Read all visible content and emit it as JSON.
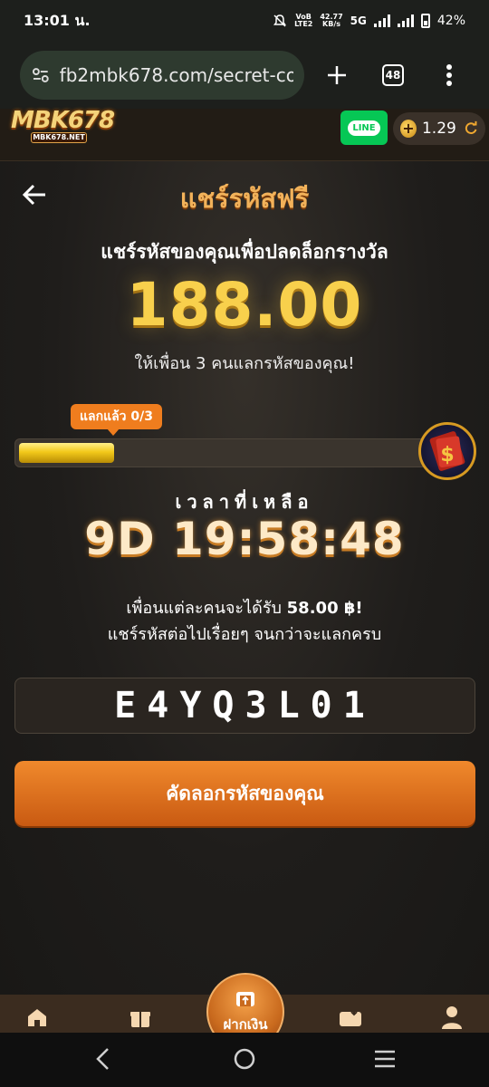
{
  "status_bar": {
    "time": "13:01 น.",
    "net_top": "VoB",
    "net_bottom": "LTE2",
    "speed_top": "42.77",
    "speed_bottom": "KB/s",
    "network": "5G",
    "battery": "42%"
  },
  "browser": {
    "url": "fb2mbk678.com/secret-co",
    "tab_count": "48"
  },
  "site_header": {
    "logo_text": "MBK678",
    "logo_sub": "MBK678.NET",
    "line_label": "LINE",
    "balance": "1.29",
    "coin_symbol": "+"
  },
  "page": {
    "title": "แชร์รหัสฟรี",
    "subtitle": "แชร์รหัสของคุณเพื่อปลดล็อกรางวัล",
    "amount": "188.00",
    "hint": "ให้เพื่อน 3 คนแลกรหัสของคุณ!",
    "progress_label": "แลกแล้ว 0/3",
    "progress_value": 0.22,
    "time_label": "เวลาที่เหลือ",
    "countdown": "9D 19:58:48",
    "info_line1_prefix": "เพื่อนแต่ละคนจะได้รับ ",
    "info_line1_amount": "58.00 ฿!",
    "info_line2": "แชร์รหัสต่อไปเรื่อยๆ จนกว่าจะแลกครบ",
    "code": "E4YQ3L01",
    "copy_button": "คัดลอกรหัสของคุณ"
  },
  "bottom_nav": {
    "deposit_label": "ฝากเงิน"
  },
  "colors": {
    "accent_orange": "#ef7d1e",
    "gold": "#f8d04c",
    "line_green": "#06c755"
  }
}
